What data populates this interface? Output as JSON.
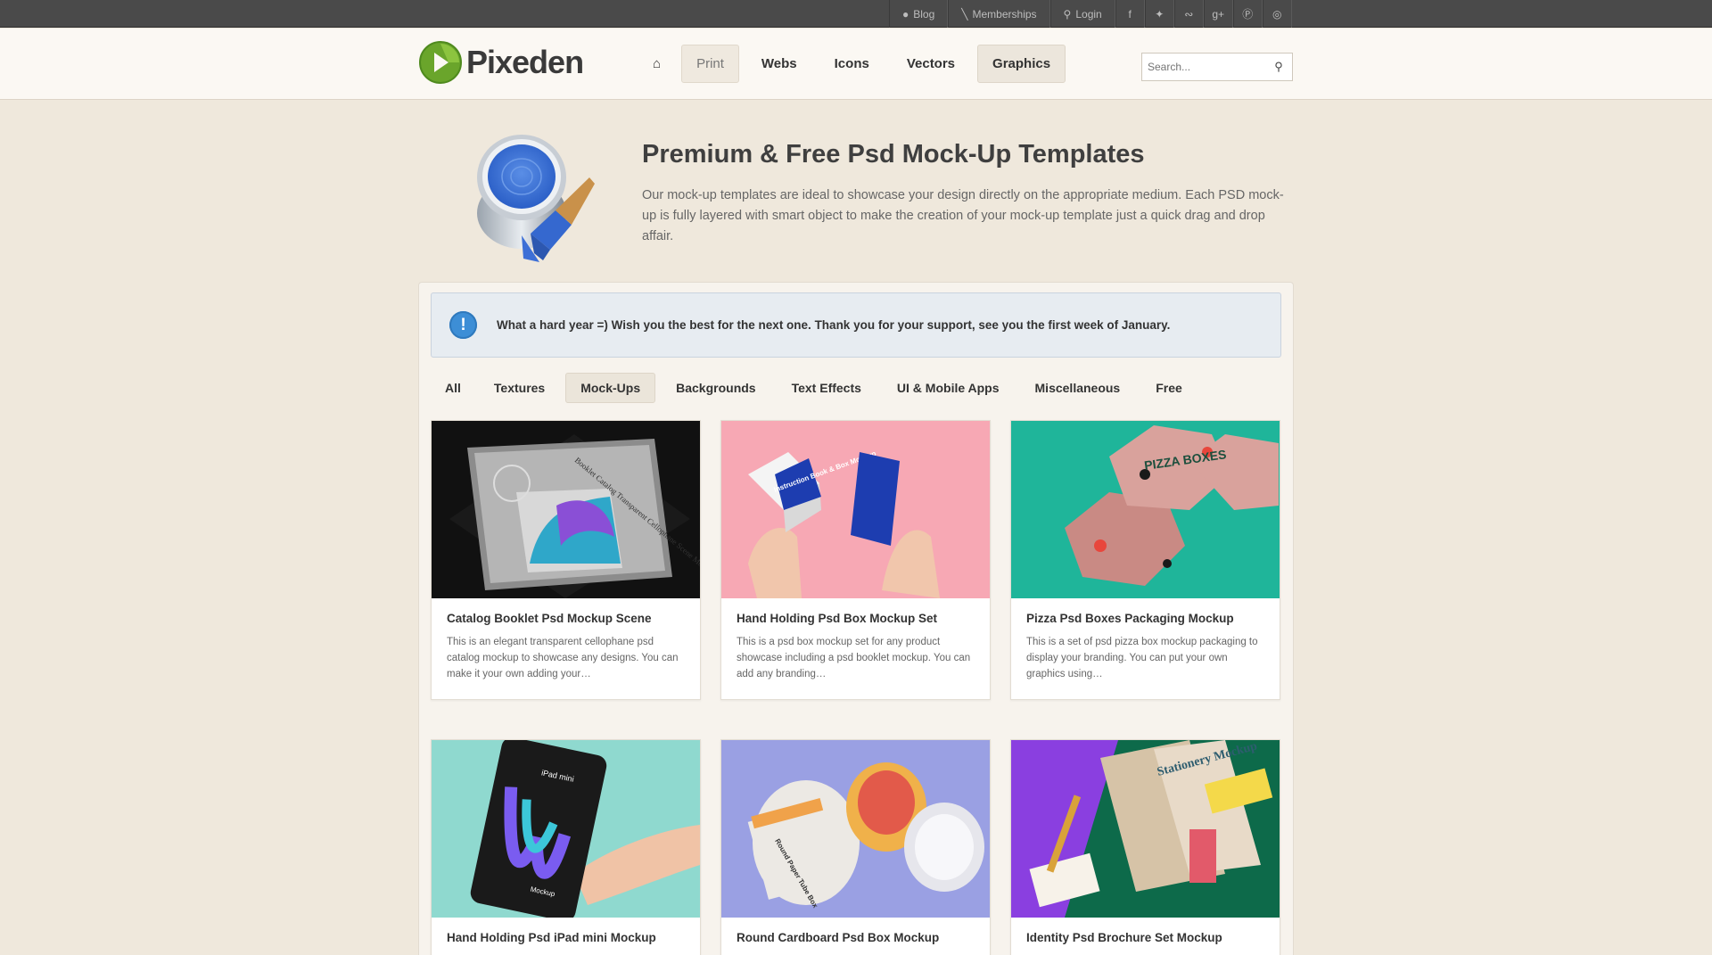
{
  "topbar": {
    "blog": "Blog",
    "memberships": "Memberships",
    "login": "Login",
    "social_icons": [
      "facebook-icon",
      "twitter-icon",
      "rss-icon",
      "googleplus-icon",
      "pinterest-icon",
      "dribbble-icon"
    ]
  },
  "header": {
    "logo_text": "Pixeden",
    "nav": [
      "Print",
      "Webs",
      "Icons",
      "Vectors",
      "Graphics"
    ],
    "search_placeholder": "Search..."
  },
  "hero": {
    "title": "Premium & Free Psd Mock-Up Templates",
    "description": "Our mock-up templates are ideal to showcase your design directly on the appropriate medium. Each PSD mock-up is fully layered with smart object to make the creation of your mock-up template just a quick drag and drop affair."
  },
  "notice": {
    "text": "What a hard year =) Wish you the best for the next one. Thank you for your support, see you the first week of January."
  },
  "tabs": [
    "All",
    "Textures",
    "Mock-Ups",
    "Backgrounds",
    "Text Effects",
    "UI & Mobile Apps",
    "Miscellaneous",
    "Free"
  ],
  "active_tab": "Mock-Ups",
  "cards": [
    {
      "title": "Catalog Booklet Psd Mockup Scene",
      "desc": "This is an elegant transparent cellophane psd catalog mockup to showcase any designs. You can make it your own adding your…"
    },
    {
      "title": "Hand Holding Psd Box Mockup Set",
      "desc": "This is a psd box mockup set for any product showcase including a psd booklet mockup. You can add any branding…"
    },
    {
      "title": "Pizza Psd Boxes Packaging Mockup",
      "desc": "This is a set of psd pizza box mockup packaging to display your branding. You can put your own graphics using…"
    },
    {
      "title": "Hand Holding Psd iPad mini Mockup",
      "desc": ""
    },
    {
      "title": "Round Cardboard Psd Box Mockup",
      "desc": ""
    },
    {
      "title": "Identity Psd Brochure Set Mockup",
      "desc": ""
    }
  ],
  "thumb_text": {
    "booklet": "Booklet Catalog Transparent Cellophane Scene Mockup",
    "box_label": "Instruction Book & Box Mockup",
    "pizza": "PIZZA BOXES",
    "ipad": "iPad mini",
    "ipad_sub": "Mockup",
    "tube": "Round Paper Tube Box",
    "identity": "Stationery Mockup"
  },
  "colors": {
    "accent_blue": "#3d8ed6",
    "pink_bg": "#f7a8b4",
    "teal_bg": "#1fb59a",
    "mint_bg": "#8fd9cf",
    "lavender_bg": "#9aa0e3"
  }
}
